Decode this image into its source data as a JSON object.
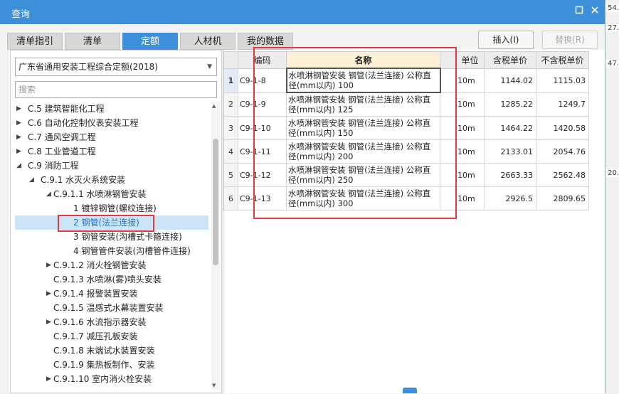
{
  "background_numbers": [
    "54.",
    "27.",
    "47.",
    "20."
  ],
  "window": {
    "title": "查询",
    "restore_icon": "restore-icon",
    "close_icon": "close-icon"
  },
  "tabs": [
    {
      "label": "清单指引"
    },
    {
      "label": "清单"
    },
    {
      "label": "定额",
      "active": true
    },
    {
      "label": "人材机"
    },
    {
      "label": "我的数据"
    }
  ],
  "buttons": {
    "insert": "插入(I)",
    "replace": "替换(R)"
  },
  "quota_select": {
    "value": "广东省通用安装工程综合定额(2018)"
  },
  "search": {
    "placeholder": "搜索"
  },
  "tree": [
    {
      "label": "C.5 建筑智能化工程",
      "level": 0,
      "toggle": "▶"
    },
    {
      "label": "C.6 自动化控制仪表安装工程",
      "level": 0,
      "toggle": "▶"
    },
    {
      "label": "C.7 通风空调工程",
      "level": 0,
      "toggle": "▶"
    },
    {
      "label": "C.8 工业管道工程",
      "level": 0,
      "toggle": "▶"
    },
    {
      "label": "C.9 消防工程",
      "level": 0,
      "toggle": "◢"
    },
    {
      "label": "C.9.1 水灭火系统安装",
      "level": 1,
      "toggle": "◢"
    },
    {
      "label": "C.9.1.1 水喷淋钢管安装",
      "level": 2,
      "toggle": "◢"
    },
    {
      "label": "1 镀锌钢管(螺纹连接)",
      "level": 3,
      "toggle": ""
    },
    {
      "label": "2 钢管(法兰连接)",
      "level": 3,
      "toggle": "",
      "selected": true
    },
    {
      "label": "3 钢管安装(沟槽式卡箍连接)",
      "level": 3,
      "toggle": ""
    },
    {
      "label": "4 钢管管件安装(沟槽管件连接)",
      "level": 3,
      "toggle": ""
    },
    {
      "label": "C.9.1.2 消火栓钢管安装",
      "level": 2,
      "toggle": "▶"
    },
    {
      "label": "C.9.1.3 水喷淋(雾)喷头安装",
      "level": 2,
      "toggle": ""
    },
    {
      "label": "C.9.1.4 报警装置安装",
      "level": 2,
      "toggle": "▶"
    },
    {
      "label": "C.9.1.5 温感式水幕装置安装",
      "level": 2,
      "toggle": ""
    },
    {
      "label": "C.9.1.6 水流指示器安装",
      "level": 2,
      "toggle": "▶"
    },
    {
      "label": "C.9.1.7 减压孔板安装",
      "level": 2,
      "toggle": ""
    },
    {
      "label": "C.9.1.8 末端试水装置安装",
      "level": 2,
      "toggle": ""
    },
    {
      "label": "C.9.1.9 集热板制作、安装",
      "level": 2,
      "toggle": ""
    },
    {
      "label": "C.9.1.10 室内消火栓安装",
      "level": 2,
      "toggle": "▶"
    }
  ],
  "grid": {
    "headers": [
      "",
      "编码",
      "名称",
      "单位",
      "含税单价",
      "不含税单价"
    ],
    "rows": [
      {
        "n": "1",
        "code": "C9-1-8",
        "name": "水喷淋钢管安装 钢管(法兰连接) 公称直径(mm以内) 100",
        "unit": "10m",
        "tax": "1144.02",
        "notax": "1115.03"
      },
      {
        "n": "2",
        "code": "C9-1-9",
        "name": "水喷淋钢管安装 钢管(法兰连接) 公称直径(mm以内) 125",
        "unit": "10m",
        "tax": "1285.22",
        "notax": "1249.7"
      },
      {
        "n": "3",
        "code": "C9-1-10",
        "name": "水喷淋钢管安装 钢管(法兰连接) 公称直径(mm以内) 150",
        "unit": "10m",
        "tax": "1464.22",
        "notax": "1420.58"
      },
      {
        "n": "4",
        "code": "C9-1-11",
        "name": "水喷淋钢管安装 钢管(法兰连接) 公称直径(mm以内) 200",
        "unit": "10m",
        "tax": "2133.01",
        "notax": "2054.76"
      },
      {
        "n": "5",
        "code": "C9-1-12",
        "name": "水喷淋钢管安装 钢管(法兰连接) 公称直径(mm以内) 250",
        "unit": "10m",
        "tax": "2663.33",
        "notax": "2562.48"
      },
      {
        "n": "6",
        "code": "C9-1-13",
        "name": "水喷淋钢管安装 钢管(法兰连接) 公称直径(mm以内) 300",
        "unit": "10m",
        "tax": "2926.5",
        "notax": "2809.65"
      }
    ]
  },
  "colors": {
    "accent": "#3c8fd9",
    "highlight": "#e0393e"
  }
}
